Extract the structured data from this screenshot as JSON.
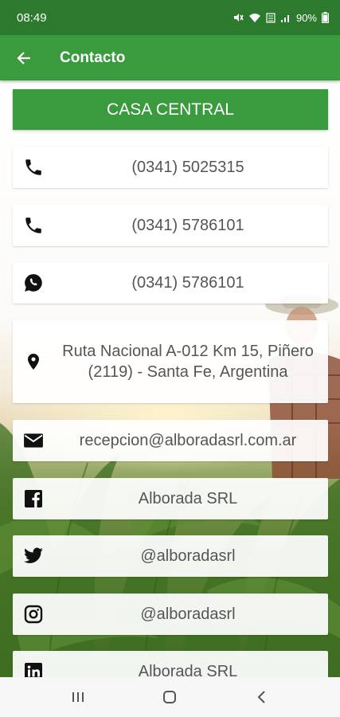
{
  "status_bar": {
    "time": "08:49",
    "battery": "90%"
  },
  "toolbar": {
    "title": "Contacto"
  },
  "header": {
    "label": "CASA CENTRAL"
  },
  "contacts": [
    {
      "icon": "phone-icon",
      "text": "(0341) 5025315"
    },
    {
      "icon": "phone-icon",
      "text": "(0341) 5786101"
    },
    {
      "icon": "whatsapp-icon",
      "text": "(0341) 5786101"
    },
    {
      "icon": "location-pin-icon",
      "text": "Ruta Nacional A-012 Km 15, Piñero (2119) - Santa Fe, Argentina"
    },
    {
      "icon": "email-icon",
      "text": "recepcion@alboradasrl.com.ar"
    },
    {
      "icon": "facebook-icon",
      "text": "Alborada SRL"
    },
    {
      "icon": "twitter-icon",
      "text": "@alboradasrl"
    },
    {
      "icon": "instagram-icon",
      "text": "@alboradasrl"
    },
    {
      "icon": "linkedin-icon",
      "text": "Alborada SRL"
    }
  ],
  "colors": {
    "status_bar": "#2b7a2e",
    "primary": "#3a9a3e",
    "card_text": "#555555"
  }
}
